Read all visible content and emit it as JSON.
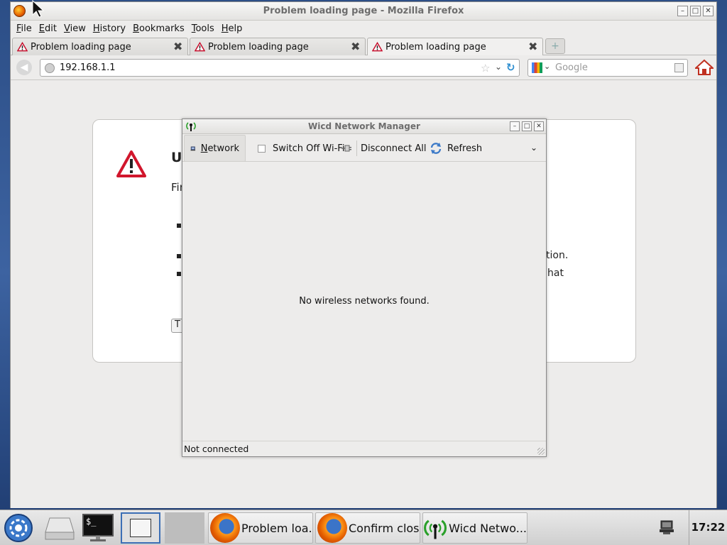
{
  "firefox": {
    "window_title": "Problem loading page - Mozilla Firefox",
    "menu": [
      {
        "underline": "F",
        "rest": "ile"
      },
      {
        "underline": "E",
        "rest": "dit"
      },
      {
        "underline": "V",
        "rest": "iew"
      },
      {
        "underline": "H",
        "rest": "istory"
      },
      {
        "underline": "B",
        "rest": "ookmarks"
      },
      {
        "underline": "T",
        "rest": "ools"
      },
      {
        "underline": "H",
        "rest": "elp"
      }
    ],
    "tabs": [
      {
        "label": "Problem loading page"
      },
      {
        "label": "Problem loading page"
      },
      {
        "label": "Problem loading page"
      }
    ],
    "url": "192.168.1.1",
    "search_placeholder": "Google",
    "error_page": {
      "title_fragment": "U",
      "text_fragment": "Fir",
      "line_fragment_2": "tion.",
      "line_fragment_3": "hat",
      "button_fragment": "T"
    }
  },
  "wicd": {
    "title": "Wicd Network Manager",
    "toolbar": {
      "network_underline": "N",
      "network_rest": "etwork",
      "switch_off_wifi": "Switch Off Wi-Fi",
      "disconnect_all": "Disconnect All",
      "refresh": "Refresh"
    },
    "empty_message": "No wireless networks found.",
    "status": "Not connected"
  },
  "taskbar": {
    "tasks": [
      {
        "label": "Problem loa..."
      },
      {
        "label": "Confirm close"
      },
      {
        "label": "Wicd Netwo..."
      }
    ],
    "clock": "17:22"
  }
}
